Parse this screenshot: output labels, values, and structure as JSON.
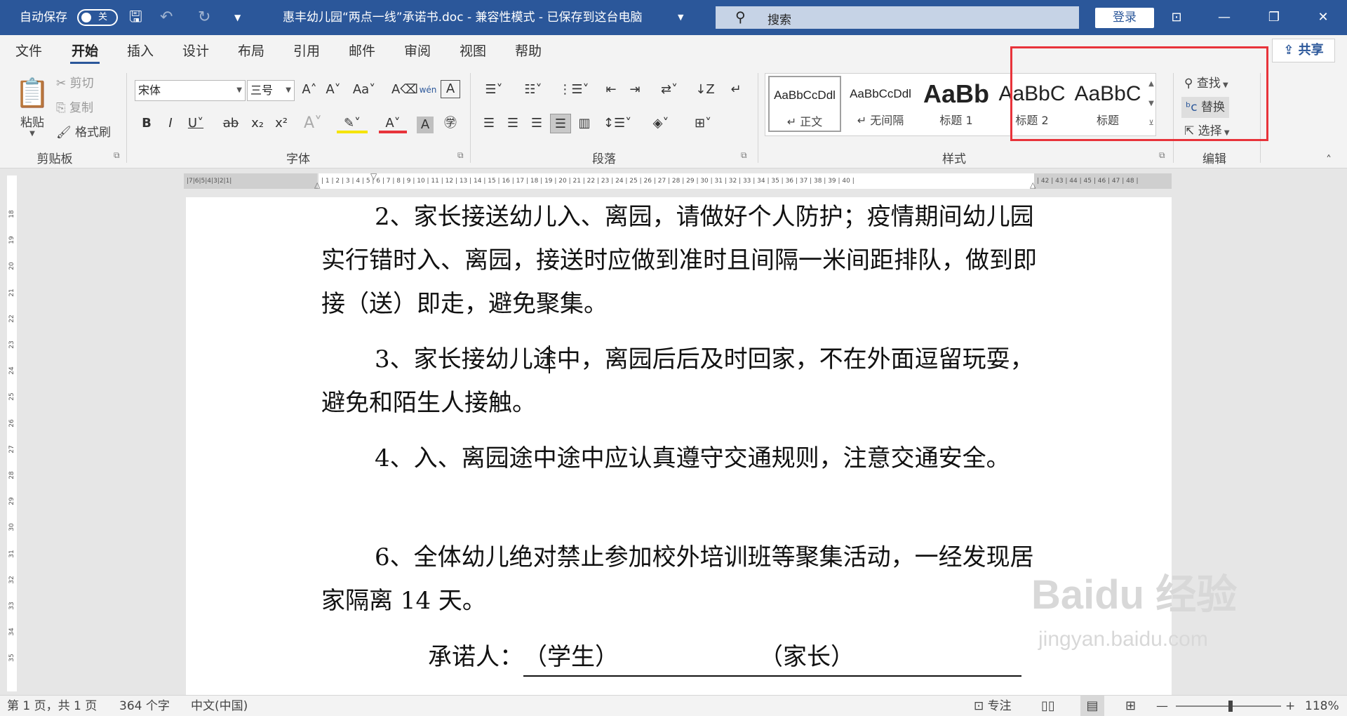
{
  "titlebar": {
    "autosave_label": "自动保存",
    "autosave_state": "关",
    "doc_title": "惠丰幼儿园“两点一线”承诺书.doc  -  兼容性模式  -  已保存到这台电脑",
    "search_placeholder": "搜索",
    "login_label": "登录"
  },
  "tabs": [
    "文件",
    "开始",
    "插入",
    "设计",
    "布局",
    "引用",
    "邮件",
    "审阅",
    "视图",
    "帮助"
  ],
  "share_label": "共享",
  "clipboard": {
    "paste": "粘贴",
    "cut": "剪切",
    "copy": "复制",
    "format_painter": "格式刷",
    "group": "剪贴板"
  },
  "font": {
    "name": "宋体",
    "size": "三号",
    "group": "字体"
  },
  "paragraph": {
    "group": "段落"
  },
  "styles": {
    "items": [
      {
        "preview": "AaBbCcDdl",
        "name": "正文"
      },
      {
        "preview": "AaBbCcDdl",
        "name": "无间隔"
      },
      {
        "preview": "AaBb",
        "name": "标题 1"
      },
      {
        "preview": "AaBbC",
        "name": "标题 2"
      },
      {
        "preview": "AaBbC",
        "name": "标题"
      }
    ],
    "group": "样式"
  },
  "editing": {
    "find": "查找",
    "replace": "替换",
    "select": "选择",
    "group": "编辑"
  },
  "ruler": {
    "left": "|7|6|5|4|3|2|1|",
    "main": "| 1 | 2 | 3 | 4 | 5 | 6 | 7 | 8 | 9 | 10 | 11 | 12 | 13 | 14 | 15 | 16 | 17 | 18 | 19 | 20 | 21 | 22 | 23 | 24 | 25 | 26 | 27 | 28 | 29 | 30 | 31 | 32 | 33 | 34 | 35 | 36 | 37 | 38 | 39 | 40 |",
    "right": "| 42 | 43 | 44 | 45 | 46 | 47 | 48 |"
  },
  "vruler": [
    "18",
    "19",
    "20",
    "21",
    "22",
    "23",
    "24",
    "25",
    "26",
    "27",
    "28",
    "29",
    "30",
    "31",
    "32",
    "33",
    "34",
    "35"
  ],
  "document": {
    "p2": "2、家长接送幼儿入、离园，请做好个人防护；疫情期间幼儿园实行错时入、离园，接送时应做到准时且间隔一米间距排队，做到即接（送）即走，避免聚集。",
    "p3": "3、家长接幼儿途中，离园后后及时回家，不在外面逗留玩耍，避免和陌生人接触。",
    "p4": "4、入、离园途中途中应认真遵守交通规则，注意交通安全。",
    "p6": "6、全体幼儿绝对禁止参加校外培训班等聚集活动，一经发现居家隔离 14 天。",
    "sign_label": "承诺人：",
    "student": "（学生）",
    "parent": "（家长）"
  },
  "status": {
    "page": "第 1 页，共 1 页",
    "words": "364 个字",
    "lang": "中文(中国)",
    "focus": "专注",
    "zoom": "118%"
  },
  "watermark": {
    "brand": "Baidu",
    "cn": "经验",
    "url": "jingyan.baidu.com"
  }
}
